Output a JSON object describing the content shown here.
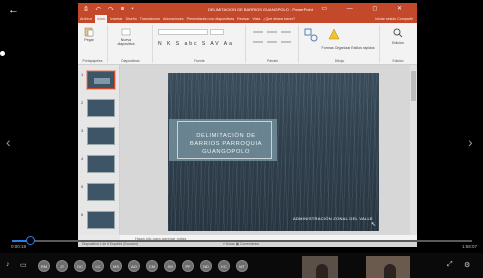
{
  "ppt": {
    "titlebar": {
      "title": "DELIMITACION DE BARRIOS GUANGPOLO - PowerPoint",
      "quick_access": "⎙ ↶ ↷ ⊞ ▾",
      "window_buttons": "▭ — ◻ ✕"
    },
    "ribbon_tabs": [
      "Archivo",
      "Inicio",
      "Insertar",
      "Diseño",
      "Transiciones",
      "Animaciones",
      "Presentación con diapositivas",
      "Revisar",
      "Vista",
      "¿Qué desea hacer?"
    ],
    "ribbon_tabs_right": "Iniciar sesión  Compartir",
    "ribbon": {
      "groups": [
        "Portapapeles",
        "Diapositivas",
        "Fuente",
        "Párrafo",
        "Dibujo",
        "Edición"
      ],
      "paste": "Pegar",
      "new_slide": "Nueva diapositiva",
      "format": "N K S abc S AV Aa",
      "arrange": "Formas Organizar",
      "quick_styles": "Estilos rápidos",
      "edit": "Edición"
    },
    "slides": [
      "1",
      "2",
      "3",
      "4",
      "5",
      "6"
    ],
    "slide": {
      "title": "DELIMITACIÓN DE BARRIOS PARROQUIA GUANGOPOLO",
      "subtitle": "ADMINISTRACIÓN ZONAL DEL VALLE"
    },
    "notes_placeholder": "Haga clic para agregar notas",
    "status": {
      "slide_info": "Diapositiva 1 de 6   Español (Ecuador)",
      "right": "≡ Notas   ▣ Comentarios"
    }
  },
  "player": {
    "time_current": "0:00:19",
    "time_total": "1:58:07",
    "progress": 0.04
  },
  "participants": [
    "RM",
    "JT",
    "DC",
    "LC",
    "MS",
    "AO",
    "CM",
    "JM",
    "PF",
    "ND",
    "KC",
    "MT"
  ],
  "icons": {
    "back": "←",
    "prev": "‹",
    "next": "›",
    "mic": "🎙",
    "camera": "📷"
  }
}
